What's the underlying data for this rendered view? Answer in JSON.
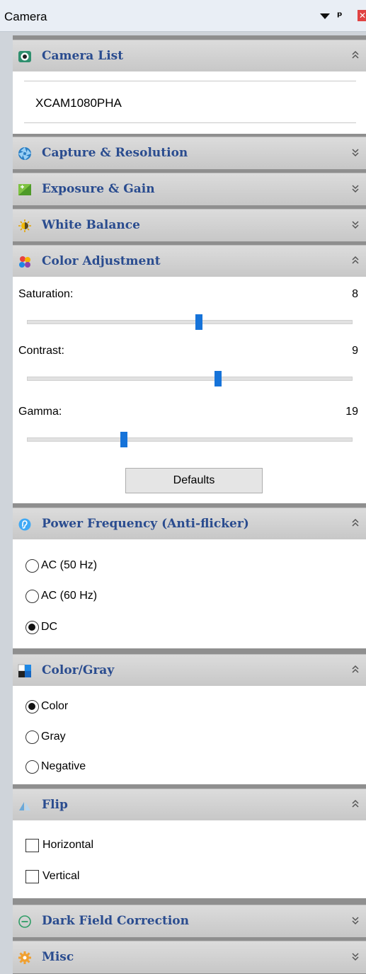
{
  "window": {
    "title": "Camera",
    "pin_glyph": "ᵖ",
    "close_glyph": "✕"
  },
  "colors": {
    "header_text": "#2a4c8f",
    "slider_thumb": "#1673d9",
    "header_bg": "#cfcfcf"
  },
  "sections": {
    "camera_list": {
      "title": "Camera List",
      "icon": "webcam-icon",
      "expanded": true,
      "items": [
        "XCAM1080PHA"
      ]
    },
    "capture_resolution": {
      "title": "Capture & Resolution",
      "icon": "aperture-icon",
      "expanded": false
    },
    "exposure_gain": {
      "title": "Exposure & Gain",
      "icon": "exposure-icon",
      "expanded": false
    },
    "white_balance": {
      "title": "White Balance",
      "icon": "sun-icon",
      "expanded": false
    },
    "color_adjustment": {
      "title": "Color Adjustment",
      "icon": "color-palette-icon",
      "expanded": true,
      "sliders": [
        {
          "label": "Saturation:",
          "value": "8",
          "position": 0.53
        },
        {
          "label": "Contrast:",
          "value": "9",
          "position": 0.59
        },
        {
          "label": "Gamma:",
          "value": "19",
          "position": 0.3
        }
      ],
      "defaults_label": "Defaults"
    },
    "power_frequency": {
      "title": "Power Frequency (Anti-flicker)",
      "icon": "ear-icon",
      "expanded": true,
      "options": [
        "AC (50 Hz)",
        "AC (60 Hz)",
        "DC"
      ],
      "selected": "DC"
    },
    "color_gray": {
      "title": "Color/Gray",
      "icon": "color-gray-icon",
      "expanded": true,
      "options": [
        "Color",
        "Gray",
        "Negative"
      ],
      "selected": "Color"
    },
    "flip": {
      "title": "Flip",
      "icon": "flip-icon",
      "expanded": true,
      "options": [
        {
          "label": "Horizontal",
          "checked": false
        },
        {
          "label": "Vertical",
          "checked": false
        }
      ]
    },
    "dark_field_correction": {
      "title": "Dark Field Correction",
      "icon": "minus-circle-icon",
      "expanded": false
    },
    "misc": {
      "title": "Misc",
      "icon": "gear-icon",
      "expanded": false
    }
  }
}
